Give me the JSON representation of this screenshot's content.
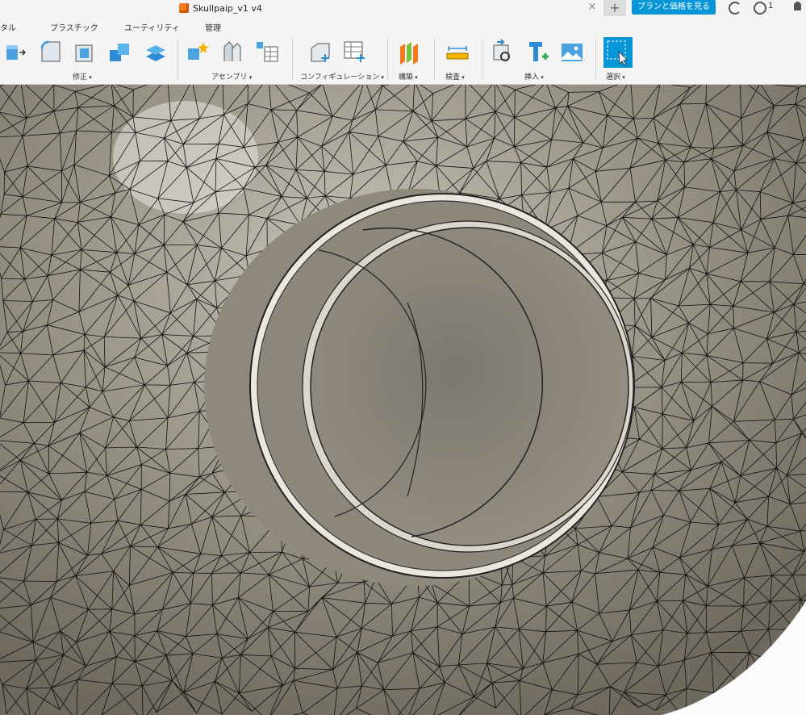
{
  "document": {
    "title": "Skullpaip_v1 v4"
  },
  "header": {
    "plan_button": "プランと価格を見る",
    "jobs_count": "1"
  },
  "workspace_tabs": [
    "タル",
    "プラスチック",
    "ユーティリティ",
    "管理"
  ],
  "toolbar_groups": {
    "modify": "修正",
    "assemble": "アセンブリ",
    "configure": "コンフィギュレーション",
    "construct": "構築",
    "inspect": "検査",
    "insert": "挿入",
    "select": "選択"
  },
  "icons": [
    "press-pull-icon",
    "fillet-icon",
    "shell-icon",
    "combine-icon",
    "offset-face-icon",
    "new-component-icon",
    "joint-icon",
    "component-table-icon",
    "configure-icon",
    "configuration-table-icon",
    "midplane-icon",
    "measure-icon",
    "insert-derive-icon",
    "insert-mesh-icon",
    "insert-canvas-icon",
    "select-icon"
  ],
  "colors": {
    "accent": "#0696d7",
    "mesh_fill": "#9c968a",
    "mesh_line": "#111111",
    "pipe": "#8a857c",
    "brand": "#f37a1e"
  }
}
